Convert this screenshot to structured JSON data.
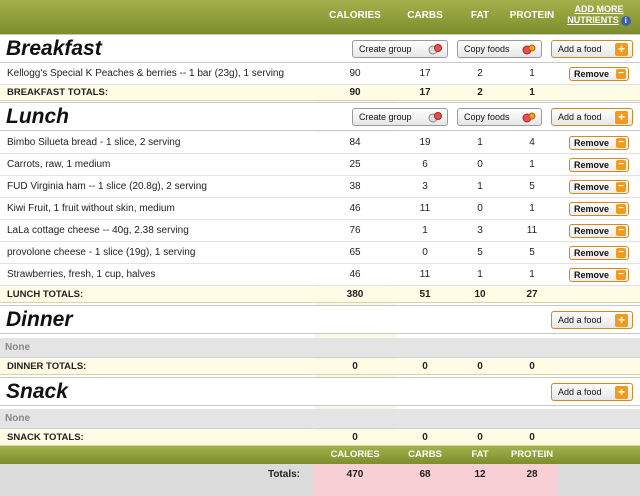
{
  "columns": {
    "calories": "CALORIES",
    "carbs": "CARBS",
    "fat": "FAT",
    "protein": "PROTEIN",
    "add_more_line1": "ADD MORE",
    "add_more_line2": "NUTRIENTS"
  },
  "buttons": {
    "create_group": "Create group",
    "copy_foods": "Copy foods",
    "add_food": "Add a food",
    "remove": "Remove"
  },
  "breakfast": {
    "title": "Breakfast",
    "items": [
      {
        "name": "Kellogg's Special K Peaches & berries -- 1 bar (23g), 1 serving",
        "cal": "90",
        "carbs": "17",
        "fat": "2",
        "protein": "1"
      }
    ],
    "totals_label": "BREAKFAST TOTALS:",
    "totals": {
      "cal": "90",
      "carbs": "17",
      "fat": "2",
      "protein": "1"
    }
  },
  "lunch": {
    "title": "Lunch",
    "items": [
      {
        "name": "Bimbo Silueta bread - 1 slice, 2 serving",
        "cal": "84",
        "carbs": "19",
        "fat": "1",
        "protein": "4"
      },
      {
        "name": "Carrots, raw, 1 medium",
        "cal": "25",
        "carbs": "6",
        "fat": "0",
        "protein": "1"
      },
      {
        "name": "FUD Virginia ham -- 1 slice (20.8g), 2 serving",
        "cal": "38",
        "carbs": "3",
        "fat": "1",
        "protein": "5"
      },
      {
        "name": "Kiwi Fruit, 1 fruit without skin, medium",
        "cal": "46",
        "carbs": "11",
        "fat": "0",
        "protein": "1"
      },
      {
        "name": "LaLa cottage cheese -- 40g, 2.38 serving",
        "cal": "76",
        "carbs": "1",
        "fat": "3",
        "protein": "11"
      },
      {
        "name": "provolone cheese - 1 slice (19g), 1 serving",
        "cal": "65",
        "carbs": "0",
        "fat": "5",
        "protein": "5"
      },
      {
        "name": "Strawberries, fresh, 1 cup, halves",
        "cal": "46",
        "carbs": "11",
        "fat": "1",
        "protein": "1"
      }
    ],
    "totals_label": "LUNCH TOTALS:",
    "totals": {
      "cal": "380",
      "carbs": "51",
      "fat": "10",
      "protein": "27"
    }
  },
  "dinner": {
    "title": "Dinner",
    "none": "None",
    "totals_label": "DINNER TOTALS:",
    "totals": {
      "cal": "0",
      "carbs": "0",
      "fat": "0",
      "protein": "0"
    }
  },
  "snack": {
    "title": "Snack",
    "none": "None",
    "totals_label": "SNACK TOTALS:",
    "totals": {
      "cal": "0",
      "carbs": "0",
      "fat": "0",
      "protein": "0"
    }
  },
  "grand": {
    "label": "Totals:",
    "cal": "470",
    "carbs": "68",
    "fat": "12",
    "protein": "28"
  },
  "colors": {
    "header_green": "#8e9c3a",
    "accent_orange": "#f29a1c",
    "grand_pink": "#f7cfd4"
  }
}
